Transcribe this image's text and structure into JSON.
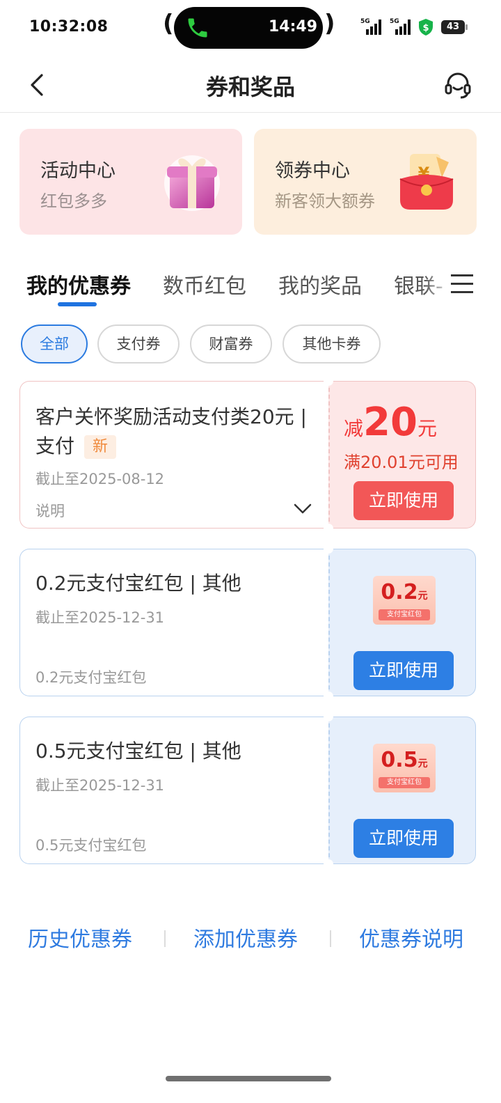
{
  "status_bar": {
    "time": "10:32:08",
    "call_timer": "14:49",
    "network_1": "5G",
    "network_2": "5G",
    "battery": "43"
  },
  "nav": {
    "title": "券和奖品",
    "back_icon": "chevron-left-icon",
    "service_icon": "headset-icon"
  },
  "promos": [
    {
      "title": "活动中心",
      "subtitle": "红包多多"
    },
    {
      "title": "领券中心",
      "subtitle": "新客领大额券"
    }
  ],
  "tabs": [
    {
      "label": "我的优惠券"
    },
    {
      "label": "数币红包"
    },
    {
      "label": "我的奖品"
    },
    {
      "label": "银联-"
    }
  ],
  "filters": [
    {
      "label": "全部"
    },
    {
      "label": "支付券"
    },
    {
      "label": "财富券"
    },
    {
      "label": "其他卡券"
    }
  ],
  "coupons": [
    {
      "title": "客户关怀奖励活动支付类20元 | 支付",
      "tag": "新",
      "deadline": "截止至2025-08-12",
      "desc": "说明",
      "discount_prefix": "减",
      "discount_amount": "20",
      "discount_unit": "元",
      "condition": "满20.01元可用",
      "button": "立即使用"
    },
    {
      "title": "0.2元支付宝红包 | 其他",
      "deadline": "截止至2025-12-31",
      "desc": "0.2元支付宝红包",
      "packet_amount": "0.2",
      "packet_unit": "元",
      "packet_label": "支付宝红包",
      "button": "立即使用"
    },
    {
      "title": "0.5元支付宝红包 | 其他",
      "deadline": "截止至2025-12-31",
      "desc": "0.5元支付宝红包",
      "packet_amount": "0.5",
      "packet_unit": "元",
      "packet_label": "支付宝红包",
      "button": "立即使用"
    }
  ],
  "bottom_links": [
    {
      "label": "历史优惠券"
    },
    {
      "label": "添加优惠券"
    },
    {
      "label": "优惠券说明"
    }
  ],
  "colors": {
    "accent_blue": "#1f73e0",
    "coupon_red": "#f25757",
    "link_blue": "#2f7be0"
  }
}
